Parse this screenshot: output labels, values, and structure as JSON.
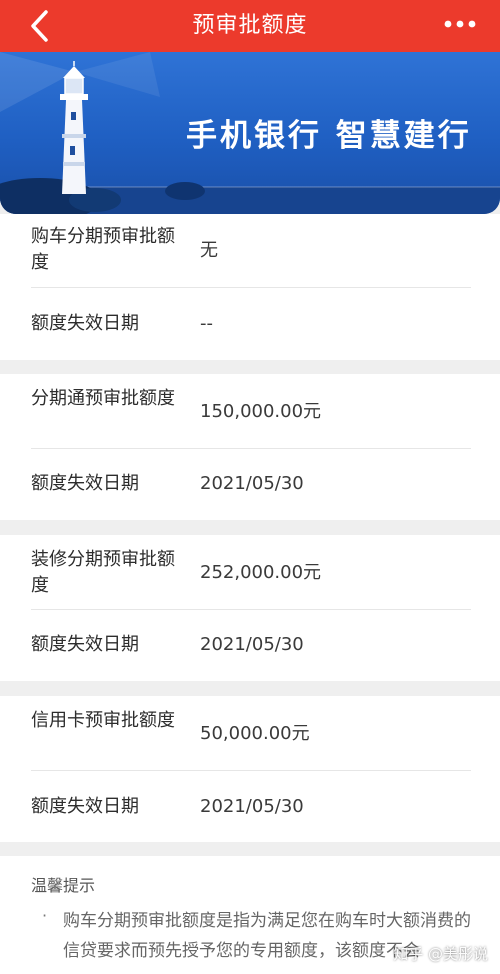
{
  "nav": {
    "title": "预审批额度"
  },
  "banner": {
    "slogan": "手机银行 智慧建行"
  },
  "cards": [
    {
      "limit_label": "购车分期预审批额度",
      "limit_value": "无",
      "expiry_label": "额度失效日期",
      "expiry_value": "--"
    },
    {
      "limit_label": "分期通预审批额度",
      "limit_value": "150,000.00元",
      "expiry_label": "额度失效日期",
      "expiry_value": "2021/05/30"
    },
    {
      "limit_label": "装修分期预审批额度",
      "limit_value": "252,000.00元",
      "expiry_label": "额度失效日期",
      "expiry_value": "2021/05/30"
    },
    {
      "limit_label": "信用卡预审批额度",
      "limit_value": "50,000.00元",
      "expiry_label": "额度失效日期",
      "expiry_value": "2021/05/30"
    }
  ],
  "tips": {
    "title": "温馨提示",
    "bullet": "·",
    "text": "购车分期预审批额度是指为满足您在购车时大额消费的信贷要求而预先授予您的专用额度，该额度不会"
  },
  "watermark": "知乎 @美彤说",
  "colors": {
    "header": "#ec3a2c",
    "banner": "#1f5fc2"
  },
  "icons": {
    "back": "chevron-left-icon",
    "more": "more-dots-icon",
    "banner_art": "lighthouse-icon"
  }
}
